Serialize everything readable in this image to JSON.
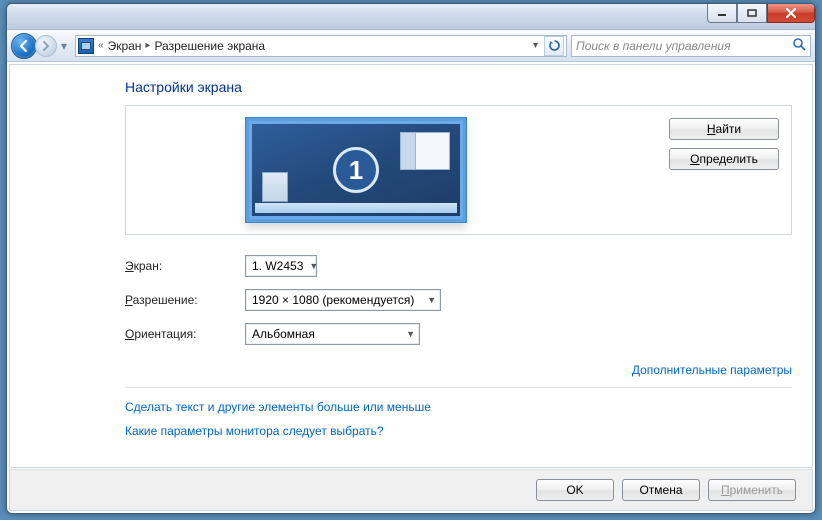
{
  "breadcrumb": {
    "part1": "Экран",
    "part2": "Разрешение экрана",
    "prefix": "«"
  },
  "search": {
    "placeholder": "Поиск в панели управления"
  },
  "heading": "Настройки экрана",
  "preview": {
    "display_number": "1"
  },
  "buttons": {
    "find": "Найти",
    "find_ul": "Н",
    "detect": "Определить",
    "detect_ul": "О",
    "ok": "OK",
    "cancel": "Отмена",
    "apply": "Применить",
    "apply_ul": "П"
  },
  "fields": {
    "display_label": "Экран:",
    "display_ul": "Э",
    "display_value": "1. W2453",
    "resolution_label": "Разрешение:",
    "resolution_ul": "Р",
    "resolution_value": "1920 × 1080 (рекомендуется)",
    "orientation_label": "Ориентация:",
    "orientation_ul": "О",
    "orientation_value": "Альбомная"
  },
  "links": {
    "advanced": "Дополнительные параметры",
    "help1": "Сделать текст и другие элементы больше или меньше",
    "help2": "Какие параметры монитора следует выбрать?"
  }
}
